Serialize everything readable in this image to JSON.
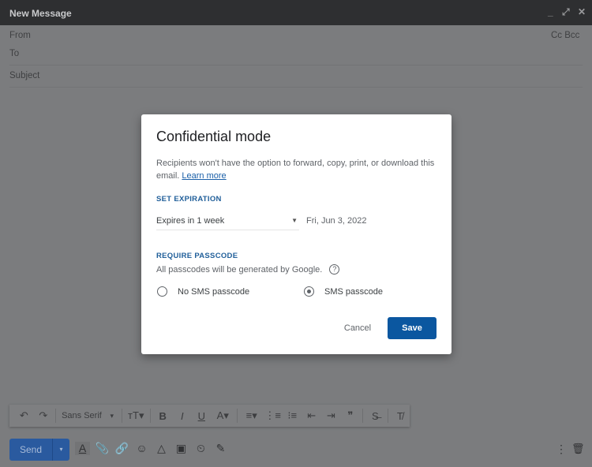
{
  "window": {
    "title": "New Message",
    "minimize": "_",
    "expand": "⤢",
    "close": "✕"
  },
  "compose": {
    "from": "From",
    "to": "To",
    "cc_bcc": "Cc Bcc",
    "subject": "Subject"
  },
  "toolbar": {
    "undo": "↶",
    "redo": "↷",
    "font": "Sans Serif",
    "font_arrow": "▾",
    "size": "ᴛT▾",
    "bold": "B",
    "italic": "I",
    "underline": "U",
    "color": "A▾",
    "align": "≡▾",
    "numbered": "⋮≡",
    "bulleted": "⁝≡",
    "indent_less": "⇤",
    "indent_more": "⇥",
    "quote": "❞",
    "strike": "S̶",
    "clear": "T̸"
  },
  "bottom": {
    "send": "Send",
    "send_more": "▾",
    "format": "A",
    "attach": "📎",
    "link": "🔗",
    "emoji": "☺",
    "drive": "△",
    "photo": "▣",
    "confidential": "⏲",
    "signature": "✎",
    "more": "⋮",
    "discard": "🗑"
  },
  "dialog": {
    "title": "Confidential mode",
    "description": "Recipients won't have the option to forward, copy, print, or download this email.",
    "learn_more": "Learn more",
    "expiration_heading": "SET EXPIRATION",
    "expiration_value": "Expires in 1 week",
    "expiration_date": "Fri, Jun 3, 2022",
    "passcode_heading": "REQUIRE PASSCODE",
    "passcode_note": "All passcodes will be generated by Google.",
    "help": "?",
    "option_no_sms": "No SMS passcode",
    "option_sms": "SMS passcode",
    "selected_option": "SMS passcode",
    "cancel": "Cancel",
    "save": "Save"
  },
  "colors": {
    "accent": "#0b57a0",
    "section": "#1f5e99"
  }
}
